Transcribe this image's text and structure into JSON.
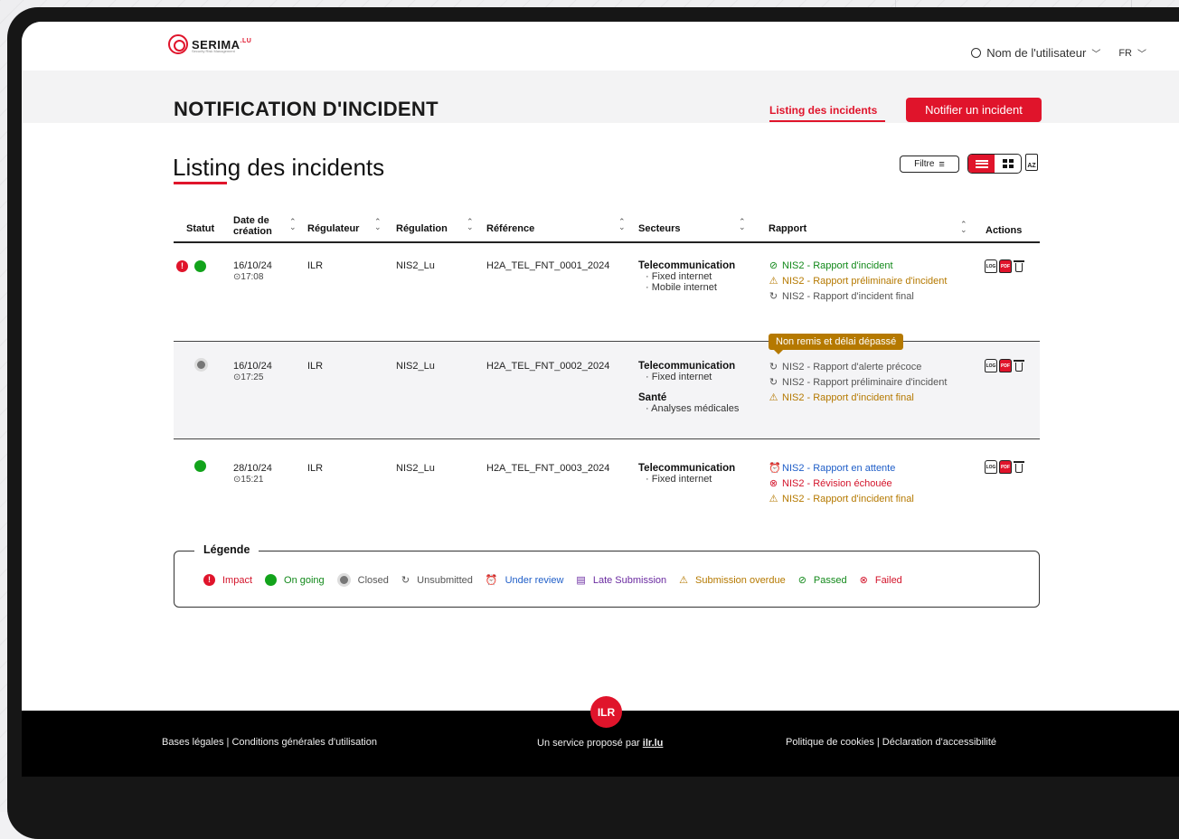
{
  "header": {
    "logo_text": "SERIMA",
    "logo_sup": ".LU",
    "logo_sub": "Security Risk Management",
    "user_name": "Nom de l'utilisateur",
    "language": "FR"
  },
  "titlebar": {
    "title": "NOTIFICATION D'INCIDENT",
    "nav_listing": "Listing des incidents",
    "notify_button": "Notifier un incident"
  },
  "listing": {
    "title": "Listing des incidents",
    "filter_label": "Filtre",
    "sort_icon_label": "AZ"
  },
  "table": {
    "headers": {
      "statut": "Statut",
      "date_1": "Date de",
      "date_2": "création",
      "regulateur": "Régulateur",
      "regulation": "Régulation",
      "reference": "Référence",
      "secteurs": "Secteurs",
      "rapport": "Rapport",
      "actions": "Actions"
    },
    "rows": [
      {
        "date": "16/10/24",
        "time": "⊙17:08",
        "regulateur": "ILR",
        "regulation": "NIS2_Lu",
        "reference": "H2A_TEL_FNT_0001_2024",
        "sector1": "Telecommunication",
        "sector1_items": [
          "· Fixed internet",
          "· Mobile internet"
        ],
        "reports": [
          {
            "status": "passed",
            "text": "NIS2 - Rapport d'incident"
          },
          {
            "status": "overdue",
            "text": "NIS2 - Rapport préliminaire d'incident"
          },
          {
            "status": "unsub",
            "text": "NIS2 - Rapport d'incident final"
          }
        ]
      },
      {
        "date": "16/10/24",
        "time": "⊙17:25",
        "regulateur": "ILR",
        "regulation": "NIS2_Lu",
        "reference": "H2A_TEL_FNT_0002_2024",
        "sector1": "Telecommunication",
        "sector1_items": [
          "· Fixed internet"
        ],
        "sector2": "Santé",
        "sector2_items": [
          "· Analyses médicales"
        ],
        "tooltip": "Non remis et délai dépassé",
        "reports": [
          {
            "status": "unsub",
            "text": "NIS2 - Rapport d'alerte précoce"
          },
          {
            "status": "unsub",
            "text": "NIS2 - Rapport préliminaire d'incident"
          },
          {
            "status": "overdue",
            "text": "NIS2 - Rapport d'incident final"
          }
        ]
      },
      {
        "date": "28/10/24",
        "time": "⊙15:21",
        "regulateur": "ILR",
        "regulation": "NIS2_Lu",
        "reference": "H2A_TEL_FNT_0003_2024",
        "sector1": "Telecommunication",
        "sector1_items": [
          "· Fixed internet"
        ],
        "reports": [
          {
            "status": "review",
            "text": "NIS2 - Rapport en attente"
          },
          {
            "status": "failed",
            "text": "NIS2 - Révision échouée"
          },
          {
            "status": "overdue",
            "text": "NIS2 - Rapport d'incident final"
          }
        ]
      }
    ],
    "impact_mark": "!",
    "log_label": "LOG",
    "pdf_label": "PDF"
  },
  "legend": {
    "title": "Légende",
    "impact": "Impact",
    "ongoing": "On going",
    "closed": "Closed",
    "unsubmitted": "Unsubmitted",
    "under_review": "Under review",
    "late_submission": "Late Submission",
    "submission_overdue": "Submission overdue",
    "passed": "Passed",
    "failed": "Failed"
  },
  "footer": {
    "badge": "ILR",
    "left": "Bases légales  |  Conditions générales d'utilisation",
    "center_prefix": "Un service proposé par ",
    "center_link": "ilr.lu",
    "right": "Politique de cookies  |  Déclaration d'accessibilité"
  },
  "colors": {
    "accent": "#e0142b",
    "passed": "#12891a",
    "overdue": "#b57900",
    "review": "#1f5ec8",
    "late": "#6a2aa0"
  }
}
